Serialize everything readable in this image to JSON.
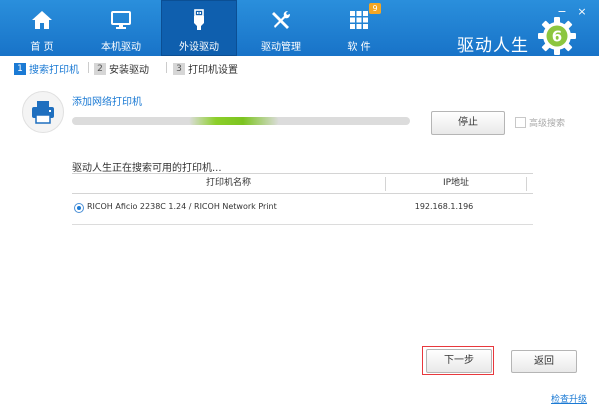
{
  "app": {
    "brand_title": "驱动人生",
    "brand_logo_digit": "6",
    "accent_color": "#1b7ad4",
    "highlight_color": "#e8383d"
  },
  "nav": {
    "items": [
      {
        "label": "首 页",
        "icon": "home-icon"
      },
      {
        "label": "本机驱动",
        "icon": "monitor-icon"
      },
      {
        "label": "外设驱动",
        "icon": "usb-icon",
        "active": true
      },
      {
        "label": "驱动管理",
        "icon": "tools-icon"
      },
      {
        "label": "软 件",
        "icon": "apps-grid-icon",
        "badge": "9"
      }
    ]
  },
  "window": {
    "minimize": "−",
    "close": "×"
  },
  "steps": [
    {
      "num": "1",
      "label": "搜索打印机",
      "active": true
    },
    {
      "num": "2",
      "label": "安装驱动"
    },
    {
      "num": "3",
      "label": "打印机设置"
    }
  ],
  "search": {
    "add_network_printer": "添加网络打印机",
    "progress_percent": 48,
    "stop_button": "停止",
    "advanced_search_label": "高级搜索",
    "advanced_search_checked": false,
    "status_text": "驱动人生正在搜索可用的打印机..."
  },
  "printer_table": {
    "columns": [
      "打印机名称",
      "IP地址"
    ],
    "rows": [
      {
        "name": "RICOH Aficio 2238C 1.24 / RICOH Network Print",
        "ip": "192.168.1.196",
        "selected": true
      }
    ]
  },
  "footer": {
    "next_button": "下一步",
    "back_button": "返回",
    "check_update": "检查升级"
  }
}
